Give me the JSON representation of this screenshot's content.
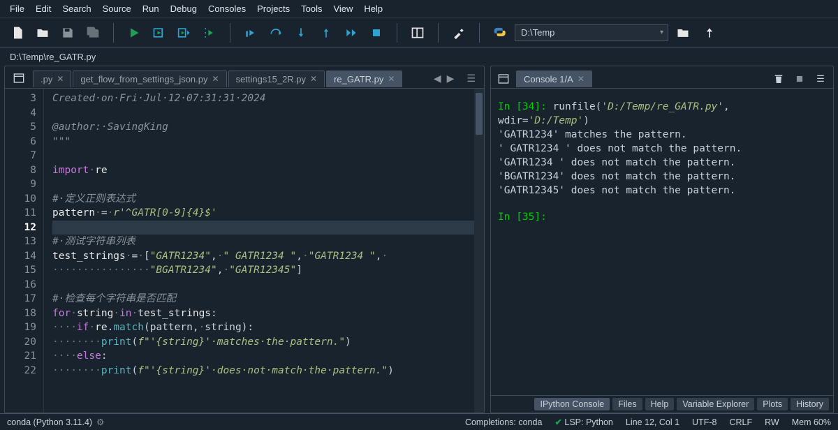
{
  "menubar": [
    "File",
    "Edit",
    "Search",
    "Source",
    "Run",
    "Debug",
    "Consoles",
    "Projects",
    "Tools",
    "View",
    "Help"
  ],
  "working_dir": "D:\\Temp",
  "pathbar": "D:\\Temp\\re_GATR.py",
  "editor_tabs": [
    {
      "label": ".py",
      "active": false,
      "close": true,
      "truncated": true
    },
    {
      "label": "get_flow_from_settings_json.py",
      "active": false,
      "close": true
    },
    {
      "label": "settings15_2R.py",
      "active": false,
      "close": true
    },
    {
      "label": "re_GATR.py",
      "active": true,
      "close": true
    }
  ],
  "line_numbers": [
    3,
    4,
    5,
    6,
    7,
    8,
    9,
    10,
    11,
    12,
    13,
    14,
    15,
    16,
    17,
    18,
    19,
    20,
    21,
    22
  ],
  "current_line": 12,
  "code_lines": [
    {
      "n": 3,
      "html": "<span class=c-comment>Created·on·Fri·Jul·12·07:31:31·2024</span>"
    },
    {
      "n": 4,
      "html": ""
    },
    {
      "n": 5,
      "html": "<span class=c-comment>@author:·SavingKing</span>"
    },
    {
      "n": 6,
      "html": "<span class=c-comment>\"\"\"</span>"
    },
    {
      "n": 7,
      "html": ""
    },
    {
      "n": 8,
      "html": "<span class=c-kw>import</span><span class=c-dot>·</span><span class=c-var>re</span>"
    },
    {
      "n": 9,
      "html": ""
    },
    {
      "n": 10,
      "html": "<span class=c-comment>#·定义正则表达式</span>"
    },
    {
      "n": 11,
      "html": "<span class=c-var>pattern</span><span class=c-dot>·</span>=<span class=c-dot>·</span><span class=c-str>r'^GATR[0-9]{4}$'</span>"
    },
    {
      "n": 12,
      "html": ""
    },
    {
      "n": 13,
      "html": "<span class=c-comment>#·测试字符串列表</span>"
    },
    {
      "n": 14,
      "html": "<span class=c-var>test_strings</span><span class=c-dot>·</span>=<span class=c-dot>·</span>[<span class=c-str>\"GATR1234\"</span>,<span class=c-dot>·</span><span class=c-str>\" GATR1234 \"</span>,<span class=c-dot>·</span><span class=c-str>\"GATR1234 \"</span>,<span class=c-dot>·</span>"
    },
    {
      "n": 15,
      "html": "<span class=c-dot>················</span><span class=c-str>\"BGATR1234\"</span>,<span class=c-dot>·</span><span class=c-str>\"GATR12345\"</span>]"
    },
    {
      "n": 16,
      "html": ""
    },
    {
      "n": 17,
      "html": "<span class=c-comment>#·检查每个字符串是否匹配</span>"
    },
    {
      "n": 18,
      "html": "<span class=c-kw>for</span><span class=c-dot>·</span><span class=c-var>string</span><span class=c-dot>·</span><span class=c-kw>in</span><span class=c-dot>·</span><span class=c-var>test_strings</span>:"
    },
    {
      "n": 19,
      "html": "<span class=c-dot>····</span><span class=c-kw>if</span><span class=c-dot>·</span><span class=c-var>re</span>.<span class=c-fn>match</span>(pattern,<span class=c-dot>·</span>string):"
    },
    {
      "n": 20,
      "html": "<span class=c-dot>········</span><span class=c-fn>print</span>(<span class=c-str>f\"'{string}'·matches·the·pattern.\"</span>)"
    },
    {
      "n": 21,
      "html": "<span class=c-dot>····</span><span class=c-kw>else</span>:"
    },
    {
      "n": 22,
      "html": "<span class=c-dot>········</span><span class=c-fn>print</span>(<span class=c-str>f\"'{string}'·does·not·match·the·pattern.\"</span>)"
    }
  ],
  "console_tab": "Console 1/A",
  "console_output": {
    "prompt_in": "In [34]:",
    "runfile_call": "runfile(",
    "runfile_arg1": "'D:/Temp/re_GATR.py'",
    "wdir_lhs": "wdir=",
    "wdir_arg": "'D:/Temp'",
    "lines": [
      "'GATR1234' matches the pattern.",
      "' GATR1234 ' does not match the pattern.",
      "'GATR1234 ' does not match the pattern.",
      "'BGATR1234' does not match the pattern.",
      "'GATR12345' does not match the pattern."
    ],
    "prompt_next": "In [35]:"
  },
  "bottom_tabs": [
    {
      "label": "IPython Console",
      "active": true
    },
    {
      "label": "Files",
      "active": false
    },
    {
      "label": "Help",
      "active": false
    },
    {
      "label": "Variable Explorer",
      "active": false
    },
    {
      "label": "Plots",
      "active": false
    },
    {
      "label": "History",
      "active": false
    }
  ],
  "statusbar": {
    "env": "conda (Python 3.11.4)",
    "completions": "Completions: conda",
    "lsp": "LSP: Python",
    "pos": "Line 12, Col 1",
    "encoding": "UTF-8",
    "eol": "CRLF",
    "rw": "RW",
    "mem": "Mem 60%"
  }
}
